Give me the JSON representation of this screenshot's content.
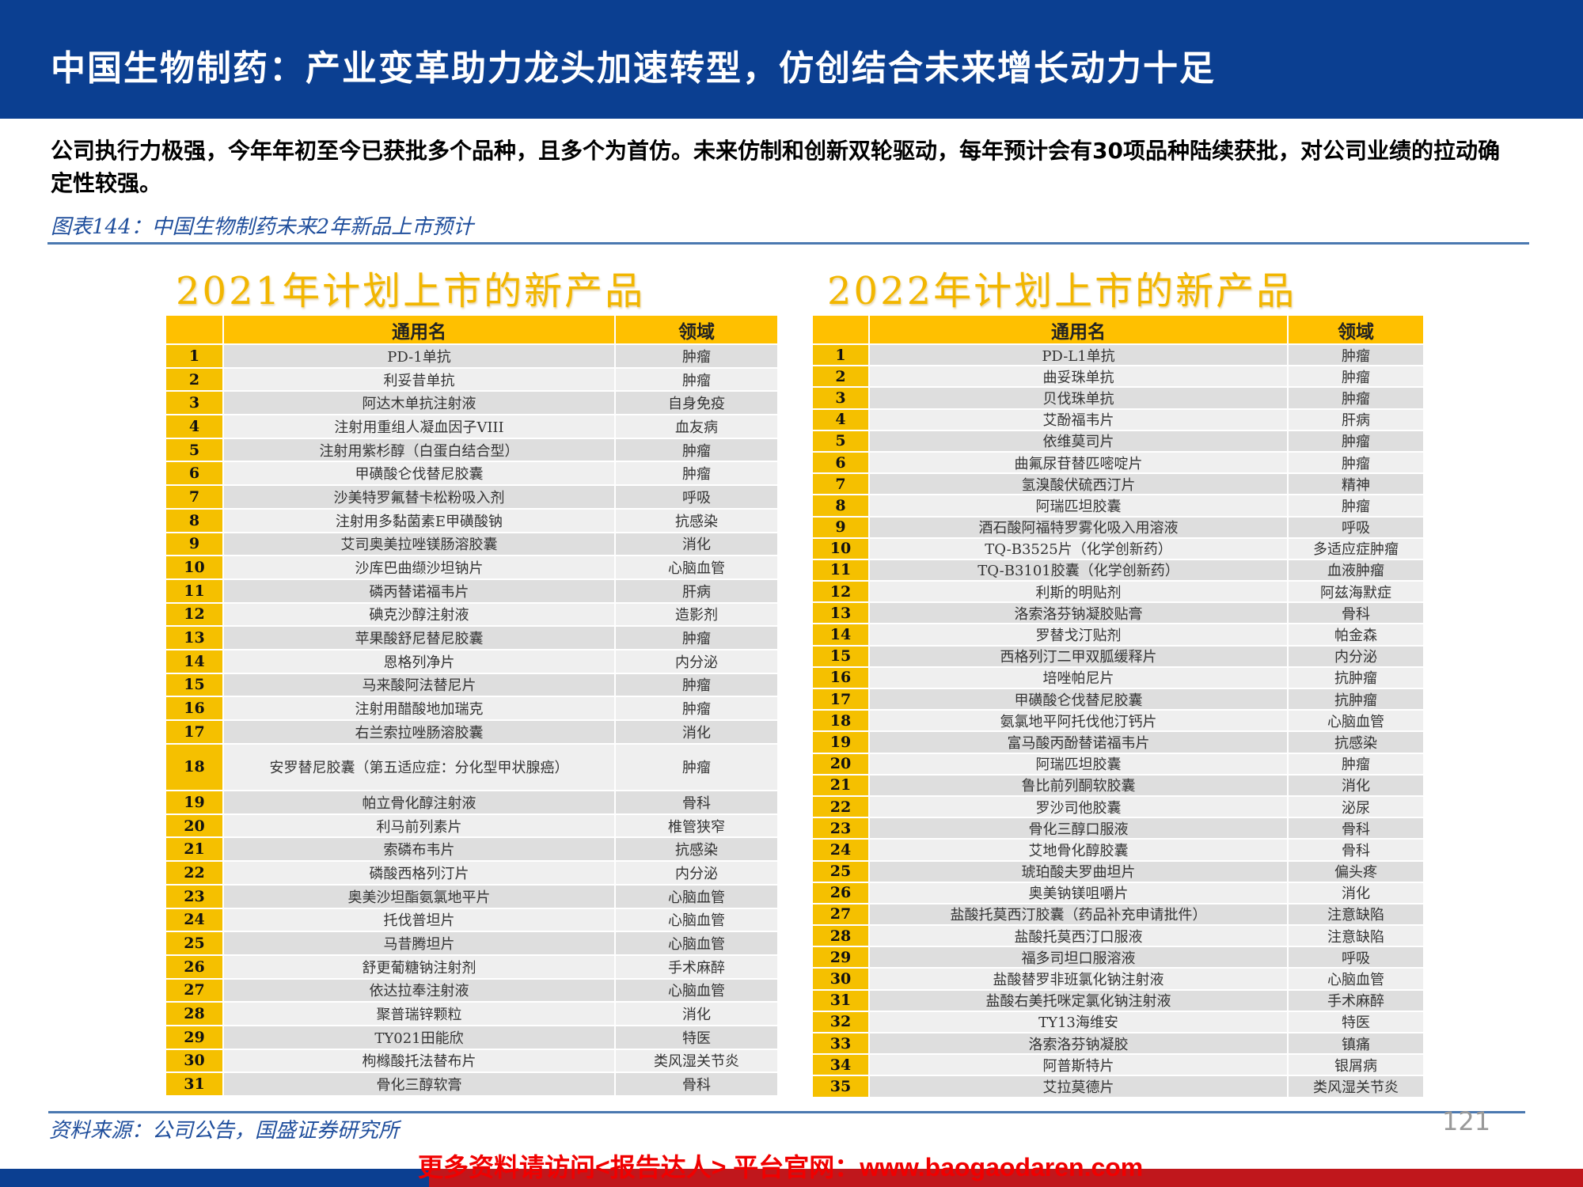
{
  "header": {
    "title": "中国生物制药：产业变革助力龙头加速转型，仿创结合未来增长动力十足"
  },
  "intro": "公司执行力极强，今年年初至今已获批多个品种，且多个为首仿。未来仿制和创新双轮驱动，每年预计会有30项品种陆续获批，对公司业绩的拉动确定性较强。",
  "caption": "图表144：中国生物制药未来2年新品上市预计",
  "colors": {
    "header_blue": "#0b3f91",
    "gold": "#ffc000",
    "footer_red": "#c0171c"
  },
  "table2021": {
    "title": "2021年计划上市的新产品",
    "headers": [
      "",
      "通用名",
      "领域"
    ],
    "rows": [
      [
        "1",
        "PD-1单抗",
        "肿瘤"
      ],
      [
        "2",
        "利妥昔单抗",
        "肿瘤"
      ],
      [
        "3",
        "阿达木单抗注射液",
        "自身免疫"
      ],
      [
        "4",
        "注射用重组人凝血因子VIII",
        "血友病"
      ],
      [
        "5",
        "注射用紫杉醇（白蛋白结合型）",
        "肿瘤"
      ],
      [
        "6",
        "甲磺酸仑伐替尼胶囊",
        "肿瘤"
      ],
      [
        "7",
        "沙美特罗氟替卡松粉吸入剂",
        "呼吸"
      ],
      [
        "8",
        "注射用多黏菌素E甲磺酸钠",
        "抗感染"
      ],
      [
        "9",
        "艾司奥美拉唑镁肠溶胶囊",
        "消化"
      ],
      [
        "10",
        "沙库巴曲缬沙坦钠片",
        "心脑血管"
      ],
      [
        "11",
        "磷丙替诺福韦片",
        "肝病"
      ],
      [
        "12",
        "碘克沙醇注射液",
        "造影剂"
      ],
      [
        "13",
        "苹果酸舒尼替尼胶囊",
        "肿瘤"
      ],
      [
        "14",
        "恩格列净片",
        "内分泌"
      ],
      [
        "15",
        "马来酸阿法替尼片",
        "肿瘤"
      ],
      [
        "16",
        "注射用醋酸地加瑞克",
        "肿瘤"
      ],
      [
        "17",
        "右兰索拉唑肠溶胶囊",
        "消化"
      ],
      [
        "18",
        "安罗替尼胶囊（第五适应症：分化型甲状腺癌）",
        "肿瘤"
      ],
      [
        "19",
        "帕立骨化醇注射液",
        "骨科"
      ],
      [
        "20",
        "利马前列素片",
        "椎管狭窄"
      ],
      [
        "21",
        "索磷布韦片",
        "抗感染"
      ],
      [
        "22",
        "磷酸西格列汀片",
        "内分泌"
      ],
      [
        "23",
        "奥美沙坦酯氨氯地平片",
        "心脑血管"
      ],
      [
        "24",
        "托伐普坦片",
        "心脑血管"
      ],
      [
        "25",
        "马昔腾坦片",
        "心脑血管"
      ],
      [
        "26",
        "舒更葡糖钠注射剂",
        "手术麻醉"
      ],
      [
        "27",
        "依达拉奉注射液",
        "心脑血管"
      ],
      [
        "28",
        "聚普瑞锌颗粒",
        "消化"
      ],
      [
        "29",
        "TY021田能欣",
        "特医"
      ],
      [
        "30",
        "枸橼酸托法替布片",
        "类风湿关节炎"
      ],
      [
        "31",
        "骨化三醇软膏",
        "骨科"
      ]
    ]
  },
  "table2022": {
    "title": "2022年计划上市的新产品",
    "headers": [
      "",
      "通用名",
      "领域"
    ],
    "rows": [
      [
        "1",
        "PD-L1单抗",
        "肿瘤"
      ],
      [
        "2",
        "曲妥珠单抗",
        "肿瘤"
      ],
      [
        "3",
        "贝伐珠单抗",
        "肿瘤"
      ],
      [
        "4",
        "艾酚福韦片",
        "肝病"
      ],
      [
        "5",
        "依维莫司片",
        "肿瘤"
      ],
      [
        "6",
        "曲氟尿苷替匹嘧啶片",
        "肿瘤"
      ],
      [
        "7",
        "氢溴酸伏硫西汀片",
        "精神"
      ],
      [
        "8",
        "阿瑞匹坦胶囊",
        "肿瘤"
      ],
      [
        "9",
        "酒石酸阿福特罗雾化吸入用溶液",
        "呼吸"
      ],
      [
        "10",
        "TQ-B3525片（化学创新药）",
        "多适应症肿瘤"
      ],
      [
        "11",
        "TQ-B3101胶囊（化学创新药）",
        "血液肿瘤"
      ],
      [
        "12",
        "利斯的明贴剂",
        "阿兹海默症"
      ],
      [
        "13",
        "洛索洛芬钠凝胶贴膏",
        "骨科"
      ],
      [
        "14",
        "罗替戈汀贴剂",
        "帕金森"
      ],
      [
        "15",
        "西格列汀二甲双胍缓释片",
        "内分泌"
      ],
      [
        "16",
        "培唑帕尼片",
        "抗肿瘤"
      ],
      [
        "17",
        "甲磺酸仑伐替尼胶囊",
        "抗肿瘤"
      ],
      [
        "18",
        "氨氯地平阿托伐他汀钙片",
        "心脑血管"
      ],
      [
        "19",
        "富马酸丙酚替诺福韦片",
        "抗感染"
      ],
      [
        "20",
        "阿瑞匹坦胶囊",
        "肿瘤"
      ],
      [
        "21",
        "鲁比前列酮软胶囊",
        "消化"
      ],
      [
        "22",
        "罗沙司他胶囊",
        "泌尿"
      ],
      [
        "23",
        "骨化三醇口服液",
        "骨科"
      ],
      [
        "24",
        "艾地骨化醇胶囊",
        "骨科"
      ],
      [
        "25",
        "琥珀酸夫罗曲坦片",
        "偏头疼"
      ],
      [
        "26",
        "奥美钠镁咀嚼片",
        "消化"
      ],
      [
        "27",
        "盐酸托莫西汀胶囊（药品补充申请批件）",
        "注意缺陷"
      ],
      [
        "28",
        "盐酸托莫西汀口服液",
        "注意缺陷"
      ],
      [
        "29",
        "福多司坦口服溶液",
        "呼吸"
      ],
      [
        "30",
        "盐酸替罗非班氯化钠注射液",
        "心脑血管"
      ],
      [
        "31",
        "盐酸右美托咪定氯化钠注射液",
        "手术麻醉"
      ],
      [
        "32",
        "TY13海维安",
        "特医"
      ],
      [
        "33",
        "洛索洛芬钠凝胶",
        "镇痛"
      ],
      [
        "34",
        "阿普斯特片",
        "银屑病"
      ],
      [
        "35",
        "艾拉莫德片",
        "类风湿关节炎"
      ]
    ]
  },
  "footer": {
    "source": "资料来源：公司公告，国盛证券研究所",
    "page_number": "121",
    "watermark": "更多资料请访问<报告达人> 平台官网：www.baogaodaren.com"
  }
}
